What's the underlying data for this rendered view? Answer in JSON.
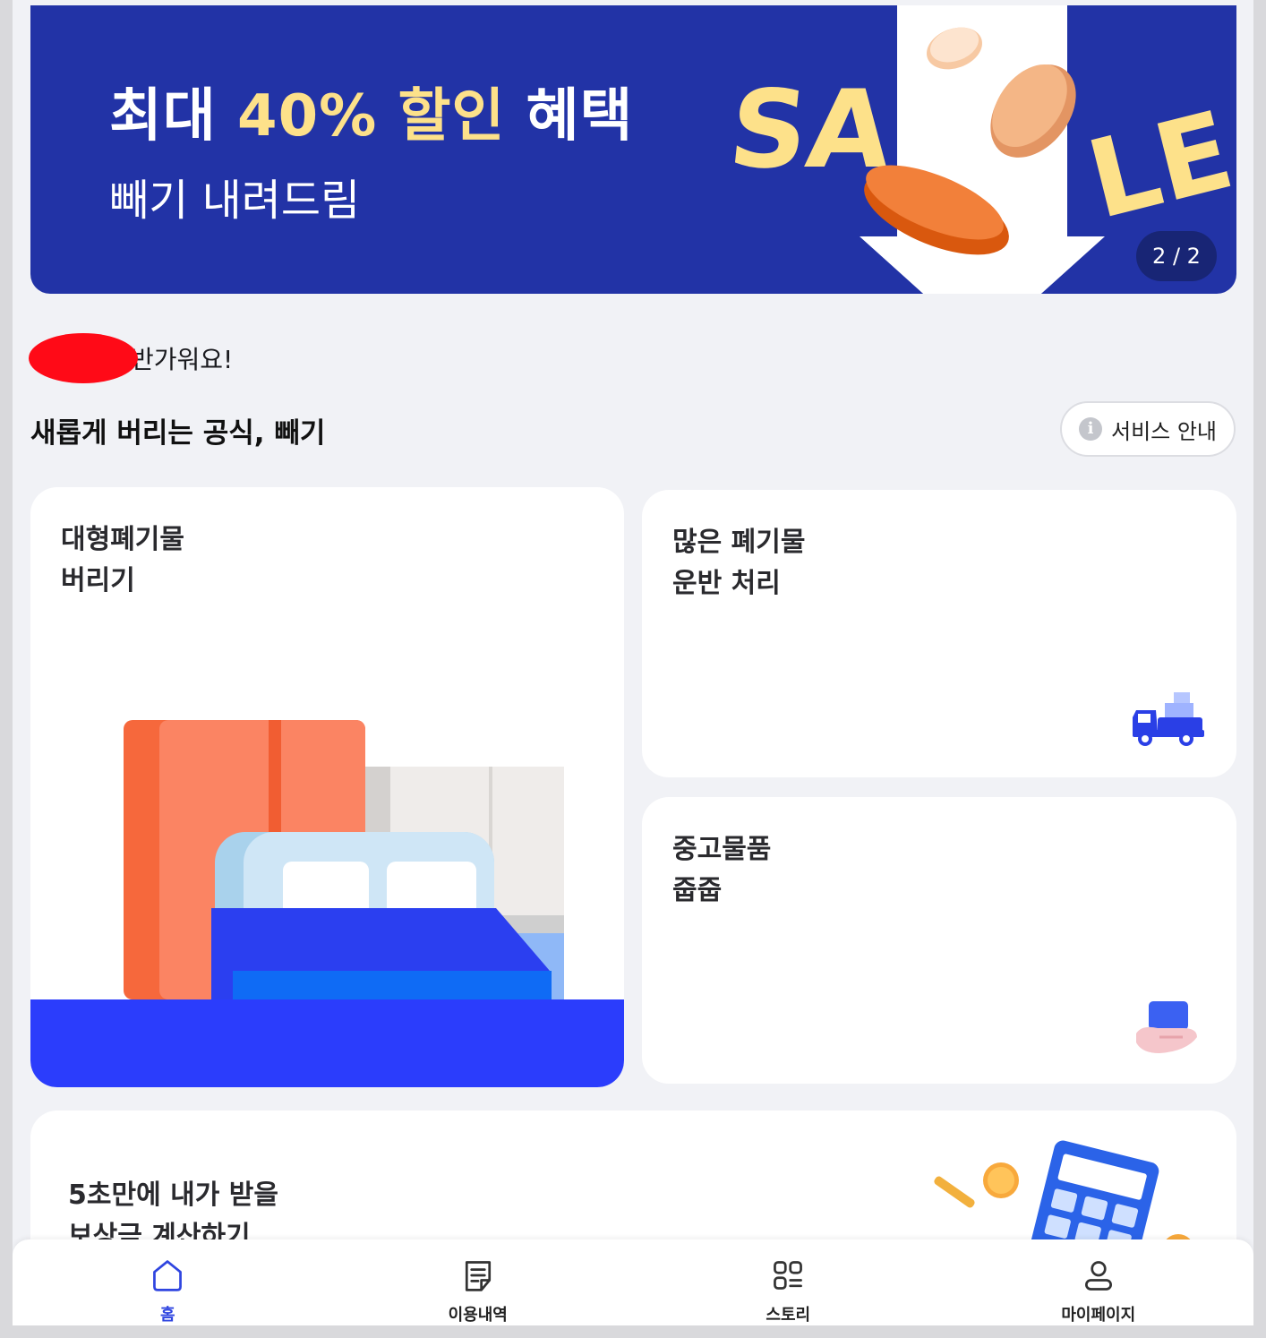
{
  "banner": {
    "title_prefix": "최대 ",
    "title_highlight": "40% 할인",
    "title_suffix": " 혜택",
    "subtitle": "빼기 내려드림",
    "sale_left": "SA",
    "sale_right": "LE",
    "slide_counter": "2 / 2",
    "bg_color": "#2233a6",
    "highlight_color": "#fde18a"
  },
  "greeting": {
    "text": "반가워요!",
    "tagline": "새롭게 버리는 공식, 빼기",
    "service_button": "서비스 안내",
    "service_icon": "info-icon"
  },
  "cards": {
    "bulky": {
      "line1": "대형폐기물",
      "line2": "버리기"
    },
    "transport": {
      "line1": "많은 폐기물",
      "line2": "운반 처리",
      "icon": "truck-icon"
    },
    "used": {
      "line1": "중고물품",
      "line2": "줍줍",
      "icon": "hand-card-icon"
    },
    "calc": {
      "line1": "5초만에 내가 받을",
      "line2": "보상금 계산하기",
      "icon": "calculator-icon"
    }
  },
  "bottom_nav": {
    "items": [
      {
        "label": "홈",
        "icon": "home-icon",
        "active": true
      },
      {
        "label": "이용내역",
        "icon": "history-icon",
        "active": false
      },
      {
        "label": "스토리",
        "icon": "story-icon",
        "active": false
      },
      {
        "label": "마이페이지",
        "icon": "profile-icon",
        "active": false
      }
    ],
    "accent_color": "#2f45e0"
  }
}
